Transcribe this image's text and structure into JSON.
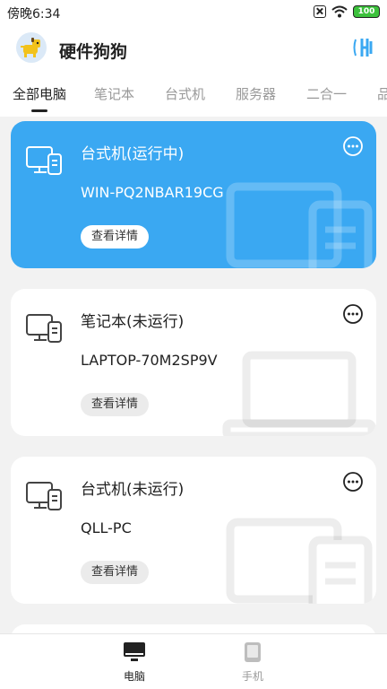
{
  "status": {
    "time": "傍晚6:34",
    "battery": "100"
  },
  "app": {
    "title": "硬件狗狗"
  },
  "tabs": [
    {
      "label": "全部电脑"
    },
    {
      "label": "笔记本"
    },
    {
      "label": "台式机"
    },
    {
      "label": "服务器"
    },
    {
      "label": "二合一"
    },
    {
      "label": "品"
    }
  ],
  "cards": [
    {
      "title": "台式机(运行中)",
      "host": "WIN-PQ2NBAR19CG",
      "button": "查看详情"
    },
    {
      "title": "笔记本(未运行)",
      "host": "LAPTOP-70M2SP9V",
      "button": "查看详情"
    },
    {
      "title": "台式机(未运行)",
      "host": "QLL-PC",
      "button": "查看详情"
    }
  ],
  "nav": [
    {
      "label": "电脑"
    },
    {
      "label": "手机"
    }
  ],
  "colors": {
    "accent": "#3aa8f2",
    "background": "#f2f2f2"
  }
}
